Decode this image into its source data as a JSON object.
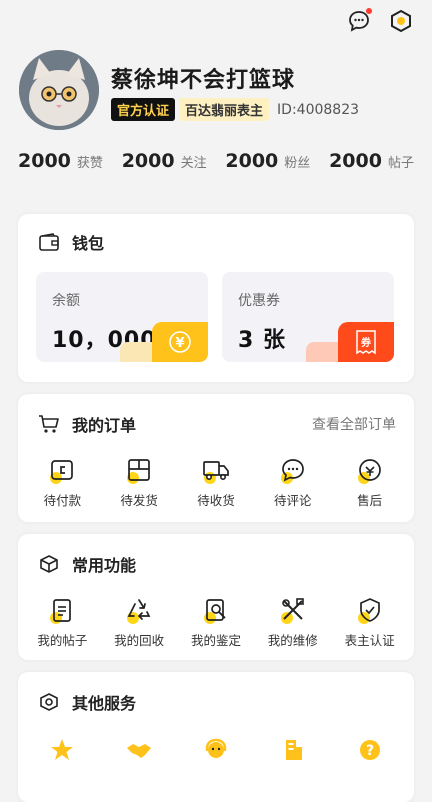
{
  "profile": {
    "username": "蔡徐坤不会打篮球",
    "badge_official": "官方认证",
    "badge_store": "百达翡丽表主",
    "user_id": "ID:4008823"
  },
  "stats": [
    {
      "value": "2000",
      "label": "获赞"
    },
    {
      "value": "2000",
      "label": "关注"
    },
    {
      "value": "2000",
      "label": "粉丝"
    },
    {
      "value": "2000",
      "label": "帖子"
    }
  ],
  "wallet": {
    "title": "钱包",
    "balance_label": "余额",
    "balance_value": "10，000",
    "coupon_label": "优惠券",
    "coupon_value": "3 张",
    "coupon_icon_text": "券",
    "balance_icon_text": "¥"
  },
  "orders": {
    "title": "我的订单",
    "view_all": "查看全部订单",
    "items": [
      {
        "label": "待付款",
        "icon": "wallet-icon"
      },
      {
        "label": "待发货",
        "icon": "package-icon"
      },
      {
        "label": "待收货",
        "icon": "truck-icon"
      },
      {
        "label": "待评论",
        "icon": "comment-icon"
      },
      {
        "label": "售后",
        "icon": "after-sale-icon"
      }
    ]
  },
  "functions": {
    "title": "常用功能",
    "items": [
      {
        "label": "我的帖子",
        "icon": "post-icon"
      },
      {
        "label": "我的回收",
        "icon": "recycle-icon"
      },
      {
        "label": "我的鉴定",
        "icon": "appraisal-icon"
      },
      {
        "label": "我的维修",
        "icon": "repair-icon"
      },
      {
        "label": "表主认证",
        "icon": "certification-icon"
      }
    ]
  },
  "services": {
    "title": "其他服务",
    "items": [
      {
        "label": "",
        "icon": "star-icon"
      },
      {
        "label": "",
        "icon": "handshake-icon"
      },
      {
        "label": "",
        "icon": "customer-service-icon"
      },
      {
        "label": "",
        "icon": "building-icon"
      },
      {
        "label": "",
        "icon": "help-icon"
      }
    ]
  },
  "colors": {
    "accent_yellow": "#ffc21a",
    "accent_red": "#ff4a1c",
    "badge_black": "#111111"
  }
}
